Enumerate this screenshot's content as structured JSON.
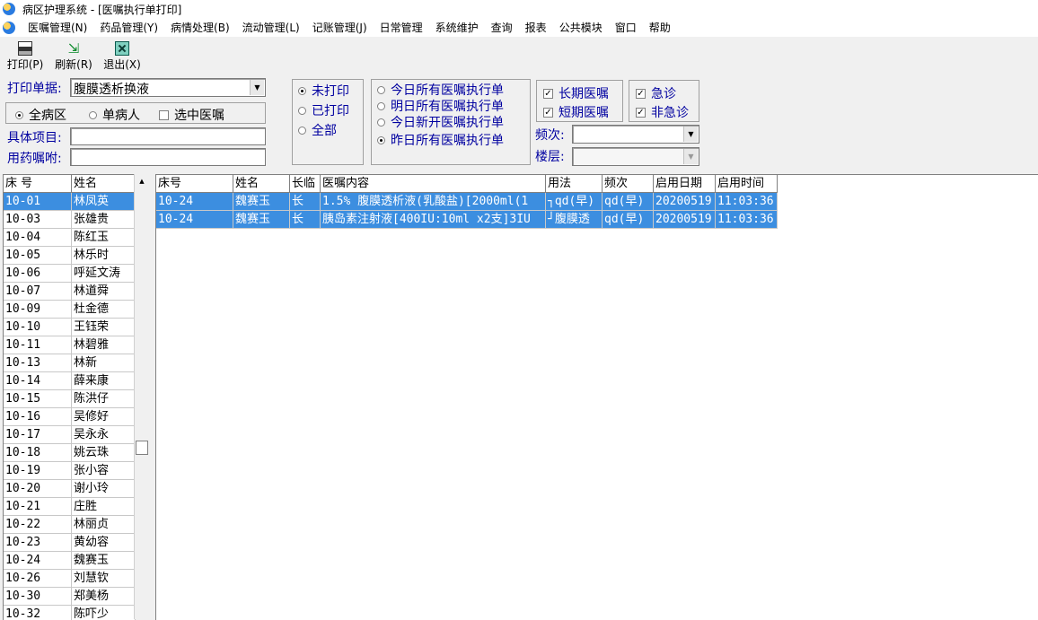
{
  "window": {
    "title": "病区护理系统 - [医嘱执行单打印]"
  },
  "menu": [
    "医嘱管理(N)",
    "药品管理(Y)",
    "病情处理(B)",
    "流动管理(L)",
    "记账管理(J)",
    "日常管理",
    "系统维护",
    "查询",
    "报表",
    "公共模块",
    "窗口",
    "帮助"
  ],
  "toolbar": {
    "print": "打印(P)",
    "refresh": "刷新(R)",
    "exit": "退出(X)"
  },
  "form": {
    "print_doc_label": "打印单据:",
    "print_doc_value": "腹膜透析换液",
    "scope": {
      "all_ward": "全病区",
      "single_patient": "单病人",
      "selected_orders": "选中医嘱"
    },
    "item_label": "具体项目:",
    "item_value": "",
    "drug_order_label": "用药嘱咐:",
    "drug_order_value": "",
    "print_status": {
      "not_printed": "未打印",
      "printed": "已打印",
      "all": "全部"
    },
    "range": {
      "today_all": "今日所有医嘱执行单",
      "tomorrow_all": "明日所有医嘱执行单",
      "today_new": "今日新开医嘱执行单",
      "yesterday_all": "昨日所有医嘱执行单"
    },
    "order_type": {
      "long": "长期医嘱",
      "short": "短期医嘱"
    },
    "urgency": {
      "urgent": "急诊",
      "non_urgent": "非急诊"
    },
    "freq_label": "频次:",
    "freq_value": "",
    "floor_label": "楼层:",
    "floor_value": ""
  },
  "patients": {
    "headers": [
      "床 号",
      "姓名"
    ],
    "rows": [
      [
        "10-01",
        "林凤英"
      ],
      [
        "10-03",
        "张雄贵"
      ],
      [
        "10-04",
        "陈红玉"
      ],
      [
        "10-05",
        "林乐时"
      ],
      [
        "10-06",
        "呼延文涛"
      ],
      [
        "10-07",
        "林道舜"
      ],
      [
        "10-09",
        "杜金德"
      ],
      [
        "10-10",
        "王钰荣"
      ],
      [
        "10-11",
        "林碧雅"
      ],
      [
        "10-13",
        "林新"
      ],
      [
        "10-14",
        "薛来康"
      ],
      [
        "10-15",
        "陈洪仔"
      ],
      [
        "10-16",
        "吴修好"
      ],
      [
        "10-17",
        "吴永永"
      ],
      [
        "10-18",
        "姚云珠"
      ],
      [
        "10-19",
        "张小容"
      ],
      [
        "10-20",
        "谢小玲"
      ],
      [
        "10-21",
        "庄胜"
      ],
      [
        "10-22",
        "林丽贞"
      ],
      [
        "10-23",
        "黄幼容"
      ],
      [
        "10-24",
        "魏赛玉"
      ],
      [
        "10-26",
        "刘慧钦"
      ],
      [
        "10-30",
        "郑美杨"
      ],
      [
        "10-32",
        "陈吓少"
      ]
    ]
  },
  "orders": {
    "headers": [
      "床号",
      "姓名",
      "长临",
      "医嘱内容",
      "用法",
      "频次",
      "启用日期",
      "启用时间"
    ],
    "rows": [
      [
        "10-24",
        "魏赛玉",
        "长",
        "1.5% 腹膜透析液(乳酸盐)[2000ml(1",
        "┐qd(早)",
        "qd(早)",
        "20200519",
        "11:03:36"
      ],
      [
        "10-24",
        "魏赛玉",
        "长",
        "胰岛素注射液[400IU:10ml x2支]3IU",
        "┘腹膜透",
        "qd(早)",
        "20200519",
        "11:03:36"
      ]
    ]
  }
}
